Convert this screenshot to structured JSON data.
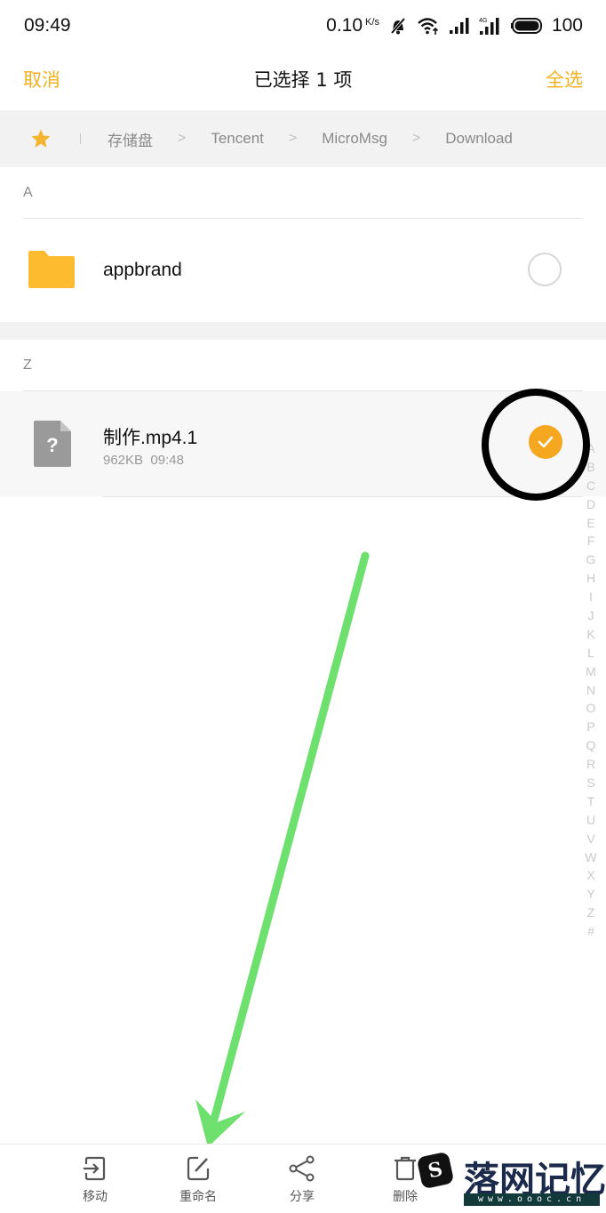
{
  "status_bar": {
    "time": "09:49",
    "net_speed": "0.10",
    "net_unit": "K/s",
    "battery": "100",
    "icons": [
      "mute-icon",
      "wifi-icon",
      "signal-icon",
      "4g-signal-icon",
      "battery-icon"
    ],
    "network_type": "4G"
  },
  "header": {
    "cancel_label": "取消",
    "title": "已选择 1 项",
    "select_all_label": "全选",
    "accent_color": "#f2b01e"
  },
  "breadcrumb": {
    "icon": "star-icon",
    "items": [
      "存储盘",
      "Tencent",
      "MicroMsg",
      "Download"
    ],
    "separator": ">"
  },
  "sections": [
    {
      "letter": "A",
      "items": [
        {
          "name": "appbrand",
          "type": "folder",
          "icon": "folder-icon",
          "selected": false
        }
      ]
    },
    {
      "letter": "Z",
      "items": [
        {
          "name": "制作.mp4.1",
          "type": "file",
          "icon": "unknown-file-icon",
          "size": "962KB",
          "time": "09:48",
          "selected": true
        }
      ]
    }
  ],
  "alphabet_index": [
    "A",
    "B",
    "C",
    "D",
    "E",
    "F",
    "G",
    "H",
    "I",
    "J",
    "K",
    "L",
    "M",
    "N",
    "O",
    "P",
    "Q",
    "R",
    "S",
    "T",
    "U",
    "V",
    "W",
    "X",
    "Y",
    "Z",
    "#"
  ],
  "bottom_bar": {
    "items": [
      {
        "label": "移动",
        "icon": "move-icon"
      },
      {
        "label": "重命名",
        "icon": "rename-icon"
      },
      {
        "label": "分享",
        "icon": "share-icon"
      },
      {
        "label": "删除",
        "icon": "delete-icon"
      }
    ]
  },
  "annotations": {
    "highlight_circle_color": "#000000",
    "arrow_color": "#6ee06e"
  },
  "watermark": {
    "text": "落网记忆",
    "url": "www.oooc.cn"
  }
}
